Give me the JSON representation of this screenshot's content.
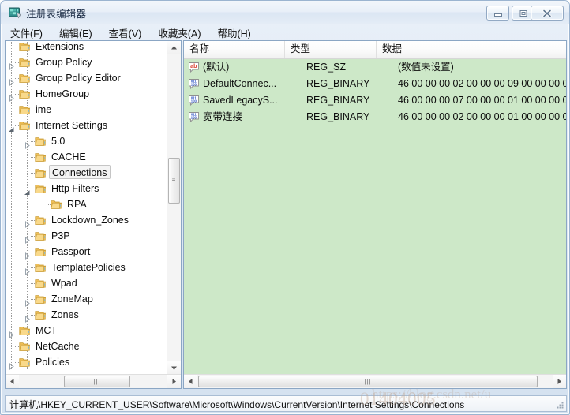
{
  "window": {
    "title": "注册表编辑器",
    "icon": "regedit-icon",
    "controls": {
      "minimize": "minimize-icon",
      "maximize": "restore-icon",
      "close": "close-icon"
    }
  },
  "menubar": {
    "items": [
      {
        "label": "文件(F)",
        "name": "menu-file"
      },
      {
        "label": "编辑(E)",
        "name": "menu-edit"
      },
      {
        "label": "查看(V)",
        "name": "menu-view"
      },
      {
        "label": "收藏夹(A)",
        "name": "menu-favorites"
      },
      {
        "label": "帮助(H)",
        "name": "menu-help"
      }
    ]
  },
  "tree": {
    "items": [
      {
        "label": "Extensions",
        "depth": 2,
        "twisty": "none",
        "selected": false
      },
      {
        "label": "Group Policy",
        "depth": 2,
        "twisty": "collapsed",
        "selected": false
      },
      {
        "label": "Group Policy Editor",
        "depth": 2,
        "twisty": "collapsed",
        "selected": false
      },
      {
        "label": "HomeGroup",
        "depth": 2,
        "twisty": "collapsed",
        "selected": false
      },
      {
        "label": "ime",
        "depth": 2,
        "twisty": "none",
        "selected": false
      },
      {
        "label": "Internet Settings",
        "depth": 2,
        "twisty": "expanded",
        "selected": false
      },
      {
        "label": "5.0",
        "depth": 3,
        "twisty": "collapsed",
        "selected": false
      },
      {
        "label": "CACHE",
        "depth": 3,
        "twisty": "none",
        "selected": false
      },
      {
        "label": "Connections",
        "depth": 3,
        "twisty": "none",
        "selected": true
      },
      {
        "label": "Http Filters",
        "depth": 3,
        "twisty": "expanded",
        "selected": false
      },
      {
        "label": "RPA",
        "depth": 4,
        "twisty": "none",
        "selected": false
      },
      {
        "label": "Lockdown_Zones",
        "depth": 3,
        "twisty": "collapsed",
        "selected": false
      },
      {
        "label": "P3P",
        "depth": 3,
        "twisty": "collapsed",
        "selected": false
      },
      {
        "label": "Passport",
        "depth": 3,
        "twisty": "collapsed",
        "selected": false
      },
      {
        "label": "TemplatePolicies",
        "depth": 3,
        "twisty": "collapsed",
        "selected": false
      },
      {
        "label": "Wpad",
        "depth": 3,
        "twisty": "none",
        "selected": false
      },
      {
        "label": "ZoneMap",
        "depth": 3,
        "twisty": "collapsed",
        "selected": false
      },
      {
        "label": "Zones",
        "depth": 3,
        "twisty": "collapsed",
        "selected": false
      },
      {
        "label": "MCT",
        "depth": 2,
        "twisty": "collapsed",
        "selected": false
      },
      {
        "label": "NetCache",
        "depth": 2,
        "twisty": "none",
        "selected": false
      },
      {
        "label": "Policies",
        "depth": 2,
        "twisty": "collapsed",
        "selected": false
      }
    ],
    "scrollbar": {
      "vertical_thumb_position_pct": 37,
      "horizontal_thumb_position_pct": 42
    }
  },
  "values": {
    "columns": [
      {
        "label": "名称",
        "name": "column-header-name"
      },
      {
        "label": "类型",
        "name": "column-header-type"
      },
      {
        "label": "数据",
        "name": "column-header-data"
      }
    ],
    "rows": [
      {
        "icon": "string-value-icon",
        "name": "(默认)",
        "type": "REG_SZ",
        "data": "(数值未设置)"
      },
      {
        "icon": "binary-value-icon",
        "name": "DefaultConnec...",
        "type": "REG_BINARY",
        "data": "46 00 00 00 02 00 00 00 09 00 00 00 00 0"
      },
      {
        "icon": "binary-value-icon",
        "name": "SavedLegacyS...",
        "type": "REG_BINARY",
        "data": "46 00 00 00 07 00 00 00 01 00 00 00 00 0"
      },
      {
        "icon": "binary-value-icon",
        "name": "宽带连接",
        "type": "REG_BINARY",
        "data": "46 00 00 00 02 00 00 00 01 00 00 00 00 0"
      }
    ],
    "scrollbar": {
      "horizontal_thumb_position_pct": 6
    }
  },
  "statusbar": {
    "path": "计算机\\HKEY_CURRENT_USER\\Software\\Microsoft\\Windows\\CurrentVersion\\Internet Settings\\Connections"
  },
  "watermark": {
    "text": "01404005",
    "text2": "https://blog.csdn.net/u"
  },
  "colors": {
    "value_pane_background": "#cde8c8",
    "window_chrome": "#dfe9f5",
    "tree_background": "#ffffff",
    "folder_icon": "#f3c96b",
    "string_icon_accent": "#d93a2b",
    "binary_icon_accent": "#2b52c4"
  }
}
